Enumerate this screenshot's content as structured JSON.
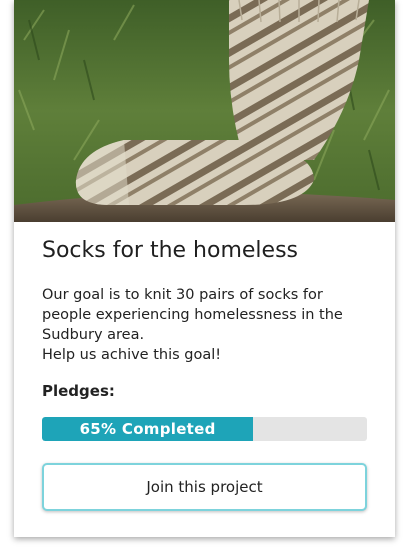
{
  "card": {
    "title": "Socks for the homeless",
    "description_lines": [
      "Our goal is to knit 30 pairs of socks for people experiencing homelessness in the Sudbury area.",
      "Help us achive this goal!"
    ],
    "pledges_label": "Pledges:",
    "progress": {
      "percent": 65,
      "label": "65% Completed"
    },
    "join_button_label": "Join this project"
  },
  "colors": {
    "progress_fill": "#1ea4b8",
    "progress_track": "#e4e4e4",
    "button_border": "#7dd3dc"
  },
  "images": {
    "hero": "photo of a hand-knitted striped wool sock on a wooden post over grass"
  }
}
